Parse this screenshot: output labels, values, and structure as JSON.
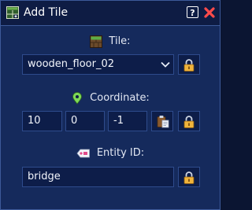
{
  "window": {
    "title": "Add Tile"
  },
  "titlebar": {
    "help_label": "?"
  },
  "tile": {
    "label": "Tile:",
    "selected_value": "wooden_floor_02"
  },
  "coordinate": {
    "label": "Coordinate:",
    "x": "10",
    "y": "0",
    "z": "-1"
  },
  "entity": {
    "label": "Entity ID:",
    "value": "bridge"
  },
  "icons": {
    "title": "tile-grid-icon",
    "close": "close-icon",
    "tile": "tile-icon",
    "coordinate": "map-pin-icon",
    "entity": "tag-icon",
    "lock": "lock-icon",
    "paste": "clipboard-paste-icon"
  },
  "colors": {
    "background": "#152a5c",
    "titlebar": "#0e1c44",
    "field": "#0d1d49",
    "border": "#3d5a9a",
    "lock_gold": "#f0b43c",
    "pin_green": "#7ed957",
    "close_red": "#ff4b4b"
  }
}
